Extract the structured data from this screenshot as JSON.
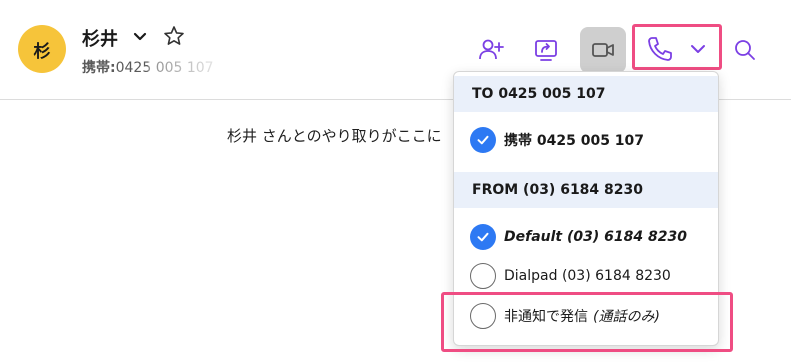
{
  "contact": {
    "avatar_initial": "杉",
    "name": "杉井",
    "phone_label": "携帯:",
    "phone_number": "0425 005 107"
  },
  "chat": {
    "placeholder_text": "杉井 さんとのやり取りがここに"
  },
  "header_icons": [
    "add-person-icon",
    "share-screen-icon",
    "video-icon",
    "phone-icon",
    "chevron-down-icon",
    "search-icon"
  ],
  "dropdown": {
    "to_header": "TO  0425 005 107",
    "to_option": "携帯 0425 005 107",
    "from_header": "FROM  (03) 6184 8230",
    "from_options": {
      "default": "Default  (03) 6184 8230",
      "dialpad": "Dialpad (03) 6184 8230",
      "hidden_main": "非通知で発信",
      "hidden_paren": "(通話のみ)"
    }
  },
  "colors": {
    "accent_purple": "#7b3fe4",
    "check_blue": "#2d79f3",
    "highlight_pink": "#ef4d83",
    "avatar_yellow": "#f6c43a",
    "section_bg": "#eaf0fa"
  }
}
